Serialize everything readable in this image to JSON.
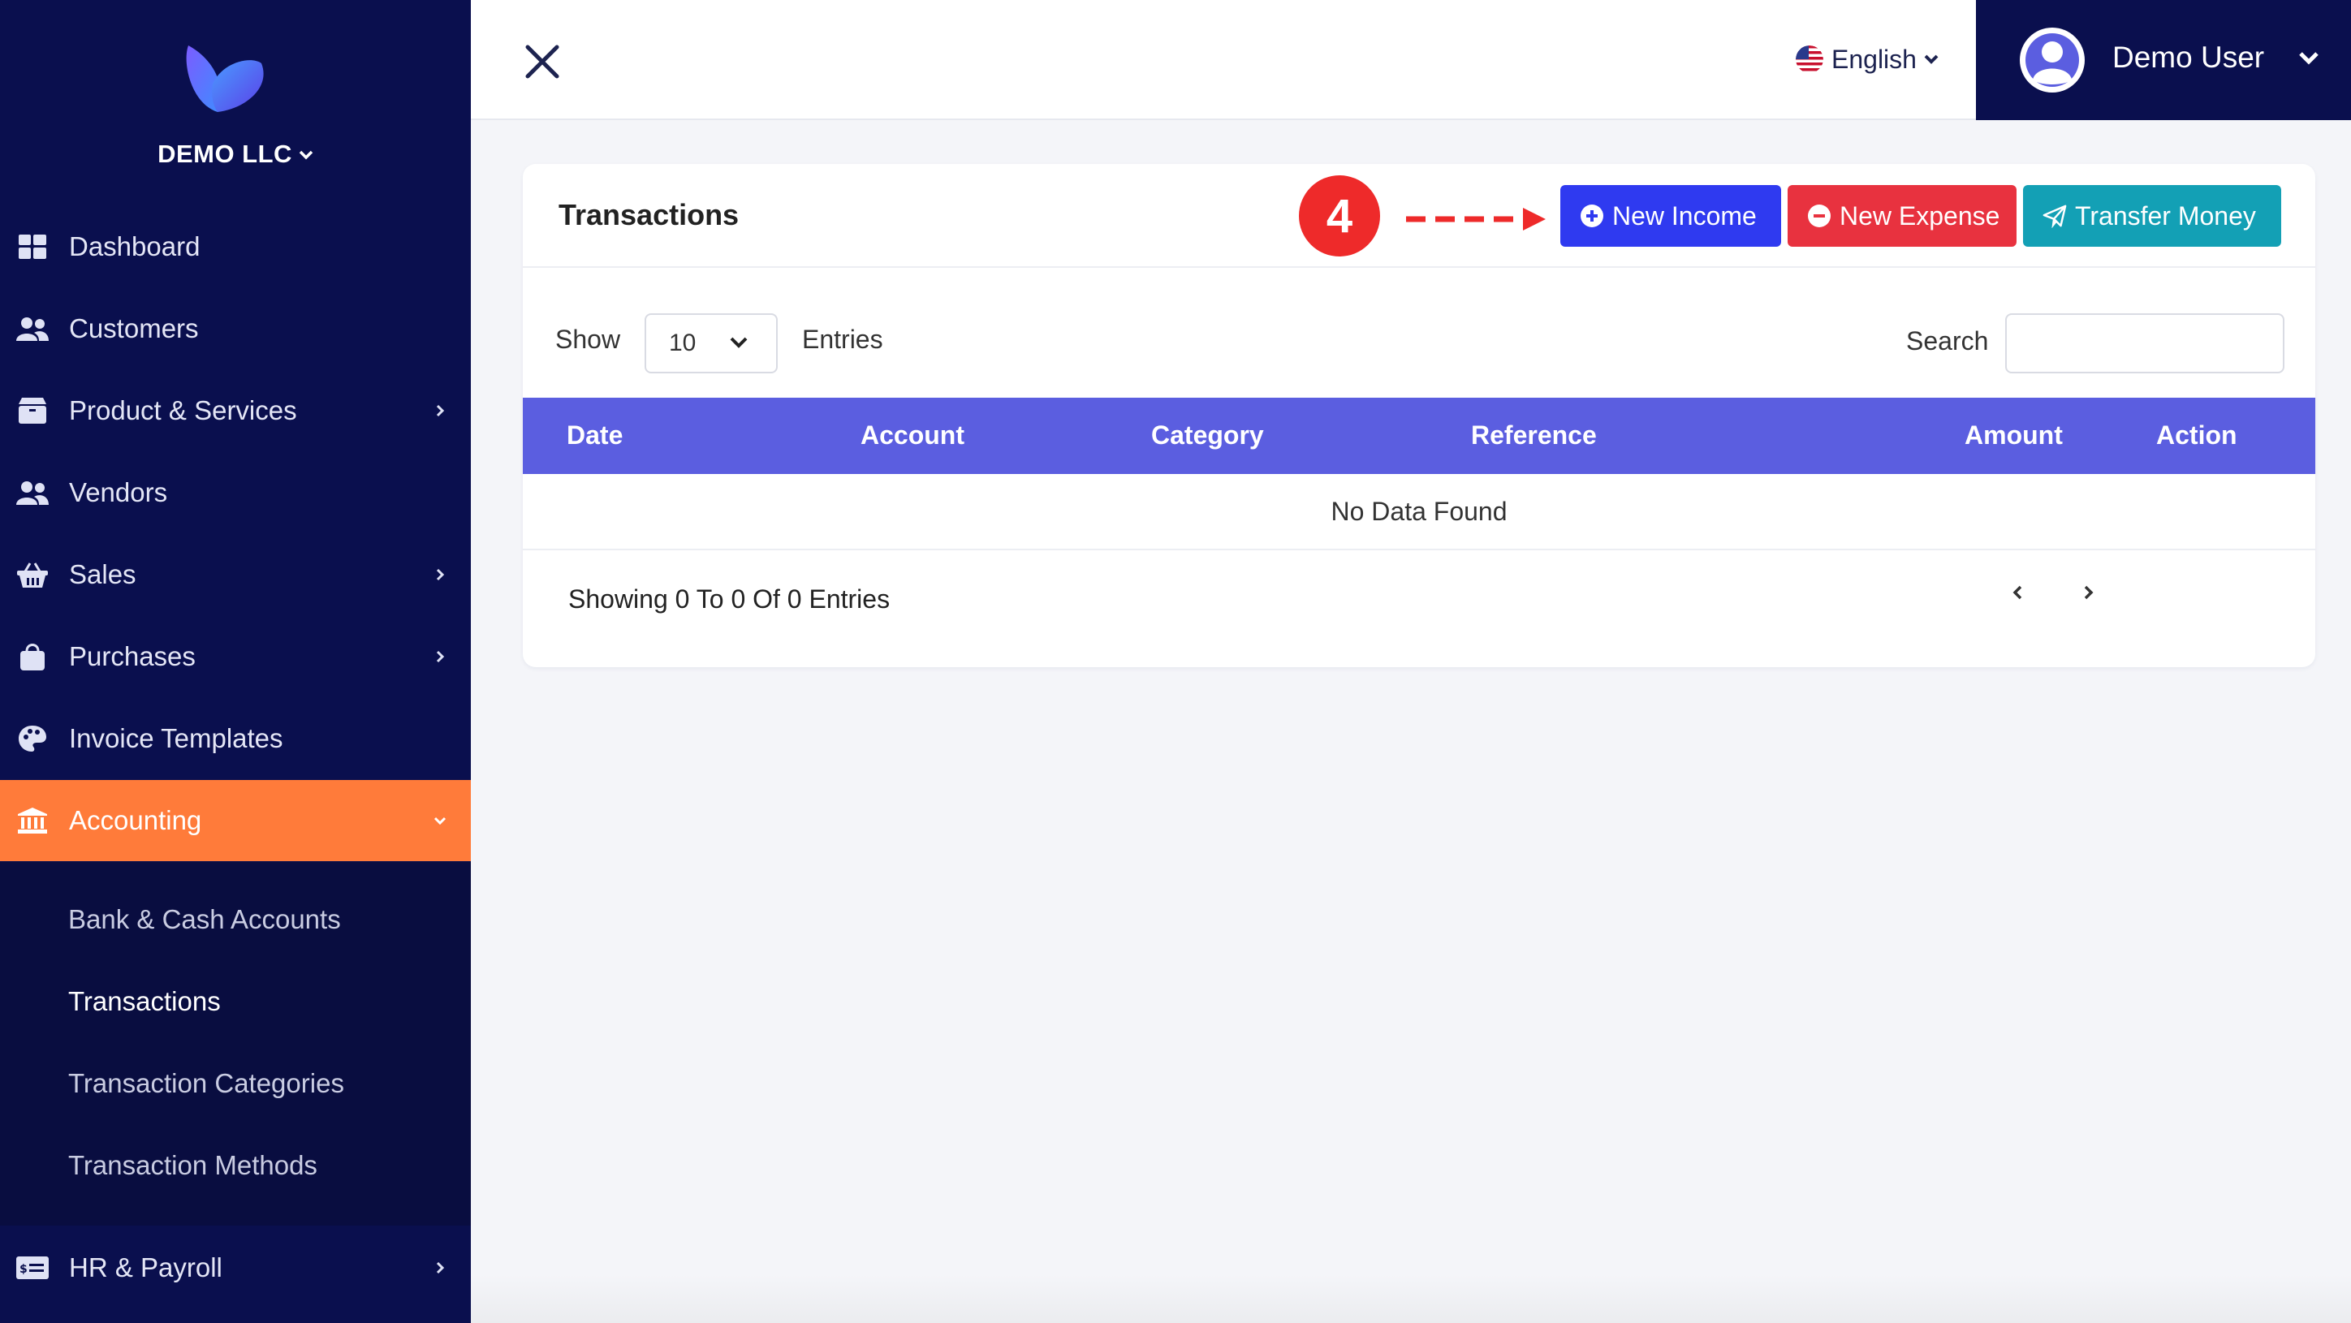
{
  "brand": {
    "name": "DEMO LLC"
  },
  "sidebar": {
    "items": [
      {
        "label": "Dashboard",
        "icon": "dashboard-icon",
        "has_arrow": false
      },
      {
        "label": "Customers",
        "icon": "users-icon",
        "has_arrow": false
      },
      {
        "label": "Product & Services",
        "icon": "box-icon",
        "has_arrow": true
      },
      {
        "label": "Vendors",
        "icon": "users-icon",
        "has_arrow": false
      },
      {
        "label": "Sales",
        "icon": "basket-icon",
        "has_arrow": true
      },
      {
        "label": "Purchases",
        "icon": "bag-icon",
        "has_arrow": true
      },
      {
        "label": "Invoice Templates",
        "icon": "palette-icon",
        "has_arrow": false
      },
      {
        "label": "Accounting",
        "icon": "bank-icon",
        "has_arrow": true,
        "active": true
      },
      {
        "label": "HR & Payroll",
        "icon": "money-card-icon",
        "has_arrow": true
      }
    ],
    "accounting_sub": [
      {
        "label": "Bank & Cash Accounts"
      },
      {
        "label": "Transactions",
        "current": true
      },
      {
        "label": "Transaction Categories"
      },
      {
        "label": "Transaction Methods"
      }
    ],
    "active_color": "#ff7b3a",
    "bg_color": "#0a0f4e"
  },
  "topbar": {
    "language": "English",
    "user_name": "Demo User"
  },
  "page": {
    "title": "Transactions",
    "step_number": "4",
    "buttons": {
      "new_income": "New Income",
      "new_expense": "New Expense",
      "transfer_money": "Transfer Money"
    },
    "button_colors": {
      "income": "#2f3af0",
      "expense": "#e8323f",
      "transfer": "#13a0b5"
    },
    "show_label": "Show",
    "entries_value": "10",
    "entries_label": "Entries",
    "search_label": "Search",
    "search_value": "",
    "table": {
      "columns": [
        "Date",
        "Account",
        "Category",
        "Reference",
        "Amount",
        "Action"
      ],
      "empty_text": "No Data Found",
      "header_color": "#5b5ee0"
    },
    "footer_info": "Showing 0 To 0 Of 0 Entries"
  }
}
